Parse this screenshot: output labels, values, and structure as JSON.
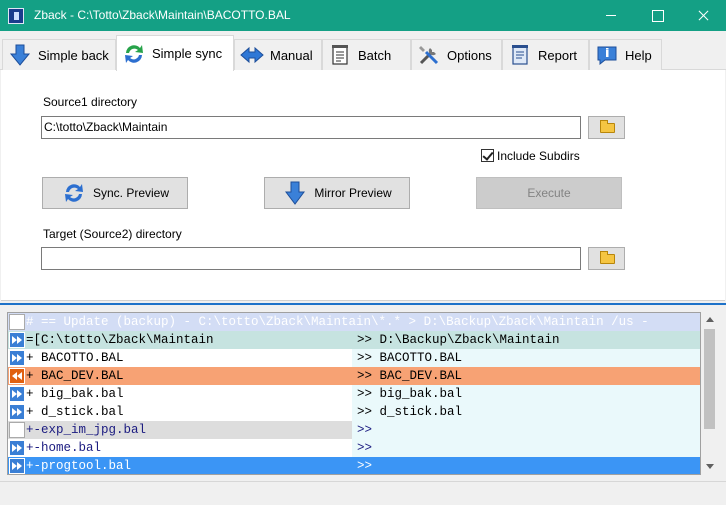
{
  "window": {
    "title": "Zback - C:\\Totto\\Zback\\Maintain\\BACOTTO.BAL"
  },
  "tabs": [
    {
      "label": "Simple back",
      "icon": "down-arrow-icon",
      "active": false
    },
    {
      "label": "Simple sync",
      "icon": "sync-icon",
      "active": true
    },
    {
      "label": "Manual",
      "icon": "bidirectional-arrow-icon",
      "active": false
    },
    {
      "label": "Batch",
      "icon": "document-icon",
      "active": false
    },
    {
      "label": "Options",
      "icon": "tools-icon",
      "active": false
    },
    {
      "label": "Report",
      "icon": "report-icon",
      "active": false
    },
    {
      "label": "Help",
      "icon": "help-icon",
      "active": false
    }
  ],
  "form": {
    "source_label": "Source1 directory",
    "source_value": "C:\\totto\\Zback\\Maintain",
    "include_subdirs_label": "Include Subdirs",
    "include_subdirs_checked": true,
    "sync_preview_label": "Sync. Preview",
    "mirror_preview_label": "Mirror Preview",
    "execute_label": "Execute",
    "execute_enabled": false,
    "target_label": "Target (Source2) directory",
    "target_value": ""
  },
  "list": {
    "header": "# == Update (backup) - C:\\totto\\Zback\\Maintain\\*.* >  D:\\Backup\\Zback\\Maintain  /us -",
    "rows": [
      {
        "left": "=[C:\\totto\\Zback\\Maintain",
        "right": ">> D:\\Backup\\Zback\\Maintain",
        "mark": "fwd"
      },
      {
        "left": "+ BACOTTO.BAL",
        "right": ">> BACOTTO.BAL",
        "mark": "fwd"
      },
      {
        "left": "+ BAC_DEV.BAL",
        "right": ">> BAC_DEV.BAL",
        "mark": "back"
      },
      {
        "left": "+ big_bak.bal",
        "right": ">> big_bak.bal",
        "mark": "fwd"
      },
      {
        "left": "+ d_stick.bal",
        "right": ">> d_stick.bal",
        "mark": "fwd"
      },
      {
        "left": "+-exp_im_jpg.bal",
        "right": ">>",
        "mark": "blank"
      },
      {
        "left": "+-home.bal",
        "right": ">>",
        "mark": "fwd"
      },
      {
        "left": "+-progtool.bal",
        "right": ">>",
        "mark": "fwd",
        "selected": true
      }
    ]
  },
  "colors": {
    "titlebar": "#14a085",
    "header_row": "#d3ddf5",
    "teal_row": "#c6e3e0",
    "light_row": "#eaf9fb",
    "orange_row": "#f7a274",
    "gray_row": "#dddddd",
    "selected_row": "#3b95f5",
    "dark_blue_text": "#1b1b80"
  }
}
